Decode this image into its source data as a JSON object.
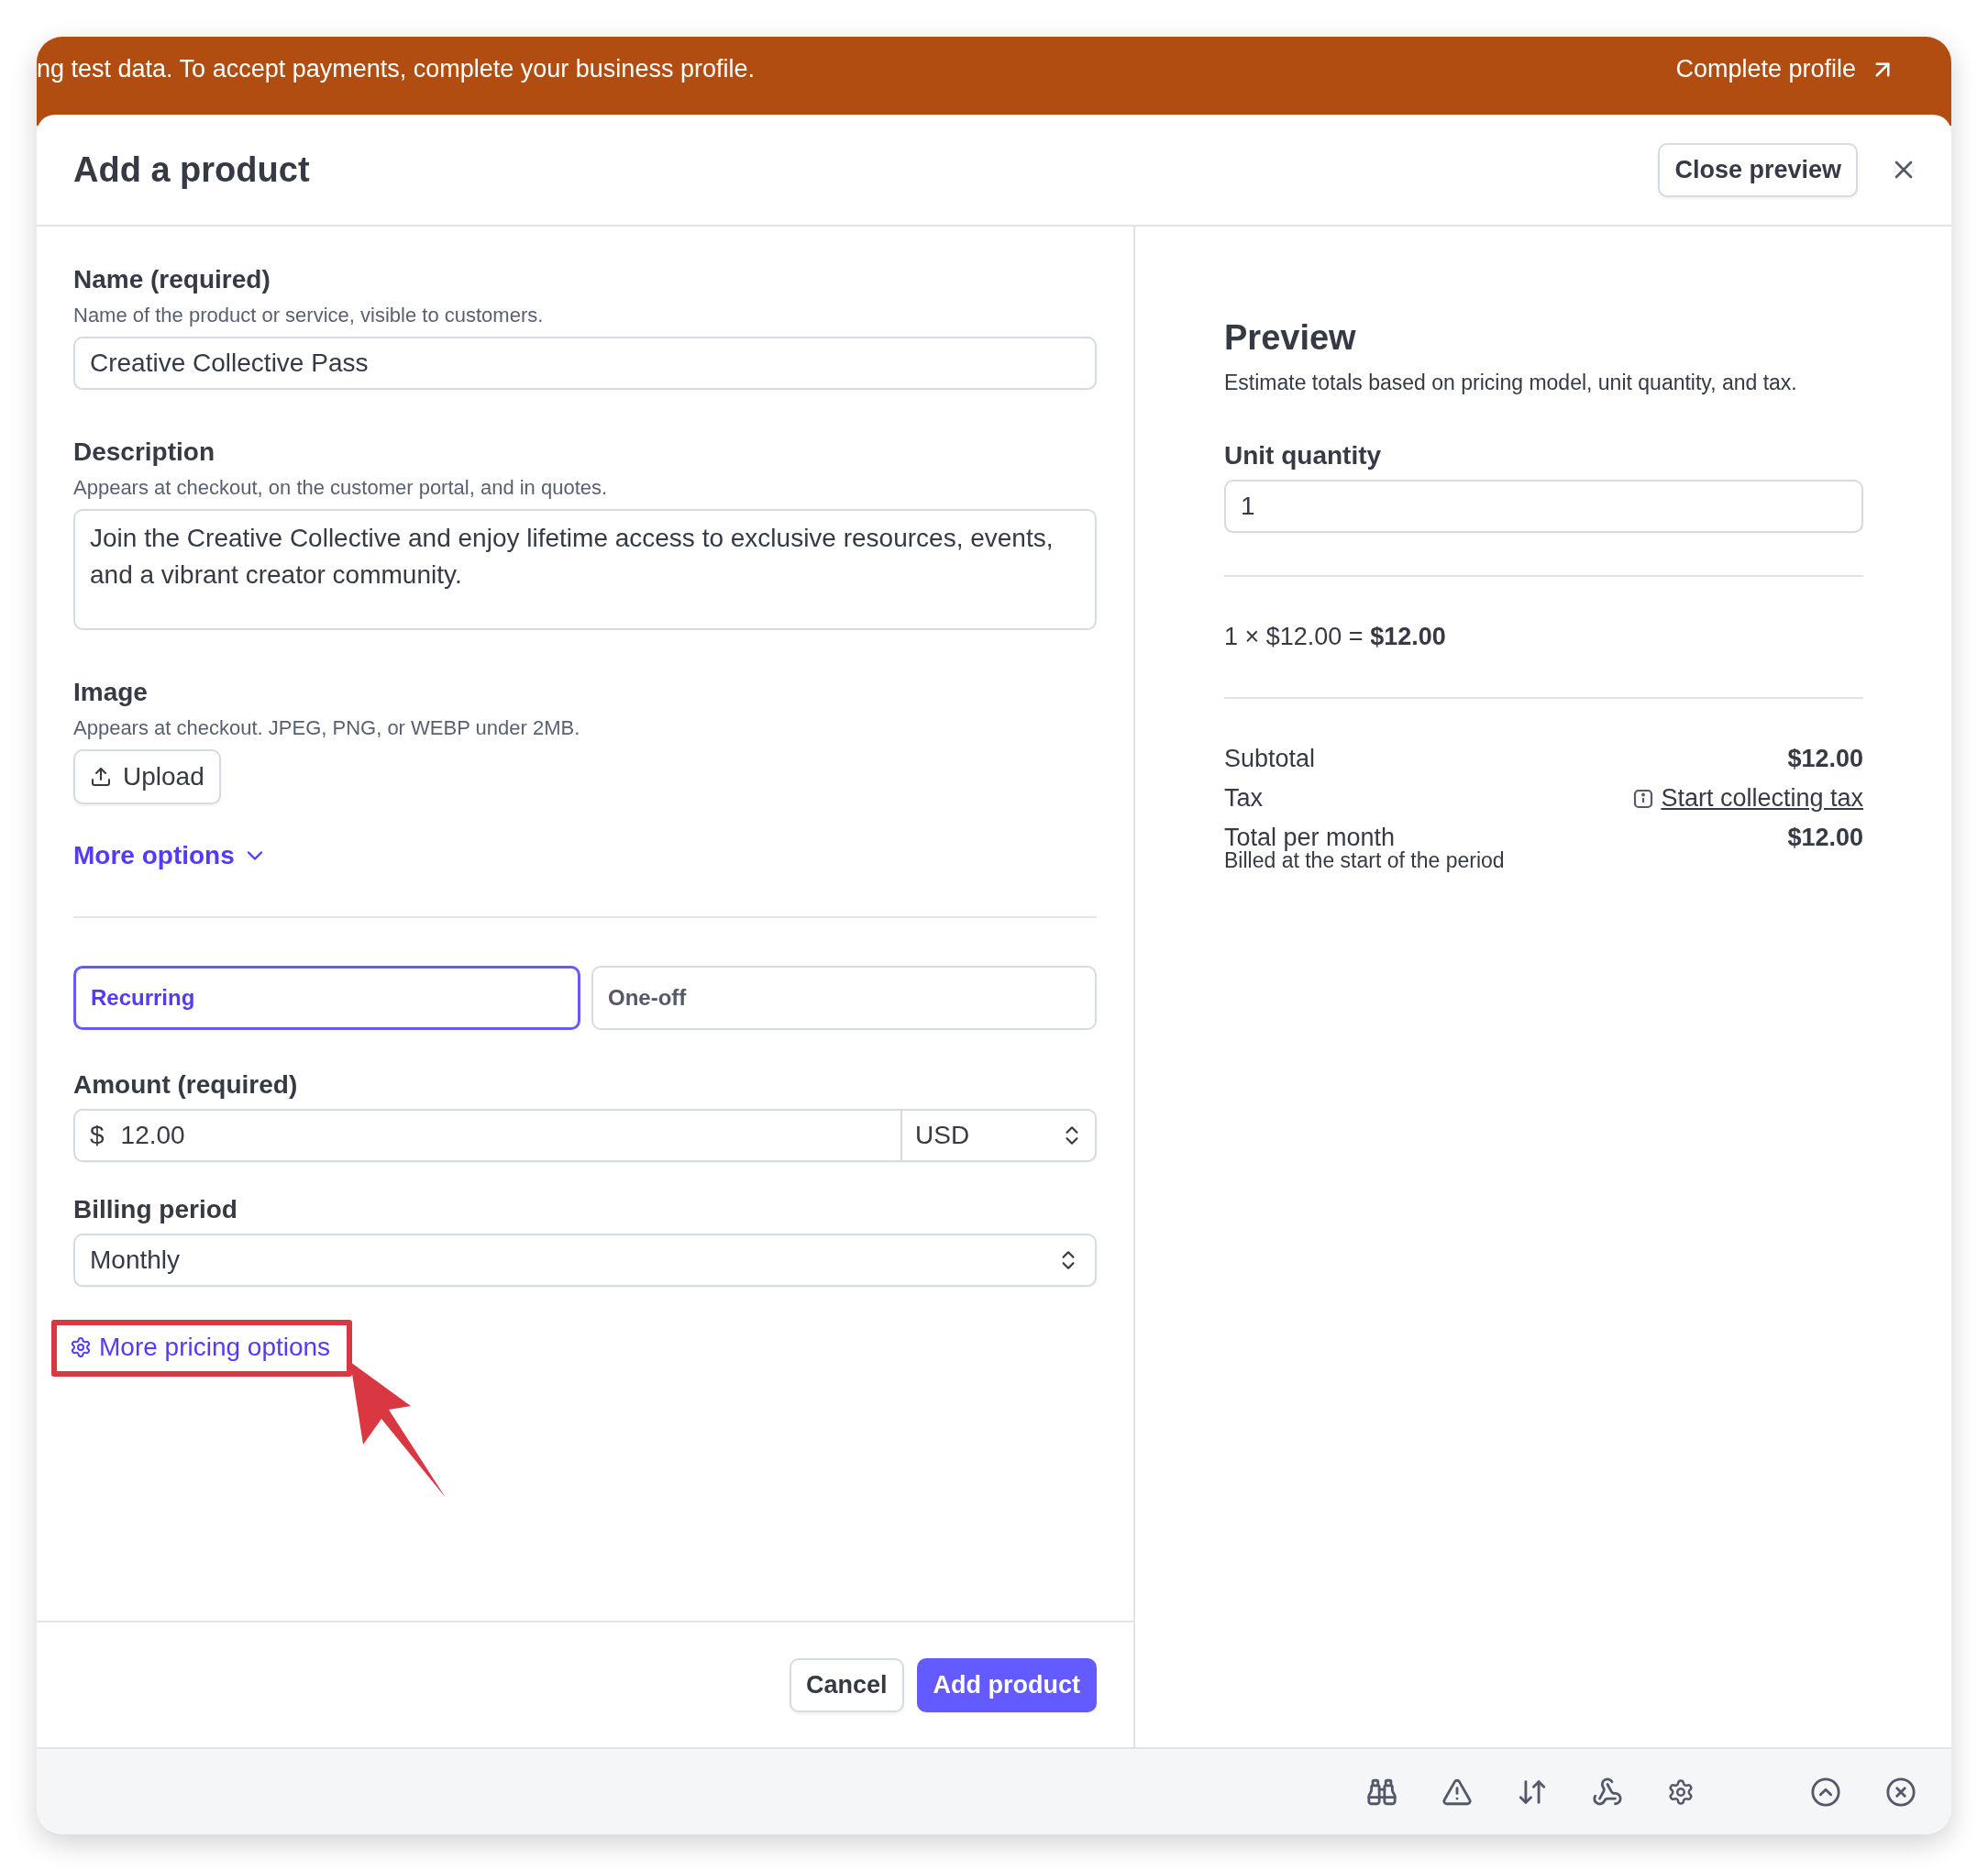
{
  "banner": {
    "message": "ng test data. To accept payments, complete your business profile.",
    "action": "Complete profile"
  },
  "header": {
    "title": "Add a product",
    "close_preview": "Close preview"
  },
  "form": {
    "name": {
      "label": "Name (required)",
      "hint": "Name of the product or service, visible to customers.",
      "value": "Creative Collective Pass"
    },
    "description": {
      "label": "Description",
      "hint": "Appears at checkout, on the customer portal, and in quotes.",
      "value": "Join the Creative Collective and enjoy lifetime access to exclusive resources, events, and a vibrant creator community."
    },
    "image": {
      "label": "Image",
      "hint": "Appears at checkout. JPEG, PNG, or WEBP under 2MB.",
      "upload": "Upload"
    },
    "more_options": "More options",
    "pricing_types": [
      {
        "label": "Recurring",
        "selected": true
      },
      {
        "label": "One-off",
        "selected": false
      }
    ],
    "amount": {
      "label": "Amount (required)",
      "currency_symbol": "$",
      "value": "12.00",
      "currency": "USD"
    },
    "billing_period": {
      "label": "Billing period",
      "value": "Monthly"
    },
    "more_pricing_options": "More pricing options"
  },
  "footer_buttons": {
    "cancel": "Cancel",
    "submit": "Add product"
  },
  "preview": {
    "title": "Preview",
    "subtitle": "Estimate totals based on pricing model, unit quantity, and tax.",
    "unit_quantity": {
      "label": "Unit quantity",
      "value": "1"
    },
    "calculation": "1 × $12.00 = **$12.00**",
    "rows": [
      {
        "kind": "amount",
        "label": "Subtotal",
        "value": "$12.00"
      },
      {
        "kind": "link",
        "label": "Tax",
        "value": "Start collecting tax"
      },
      {
        "kind": "amount",
        "label": "Total per month",
        "value": "$12.00",
        "note": "Billed at the start of the period"
      }
    ]
  }
}
